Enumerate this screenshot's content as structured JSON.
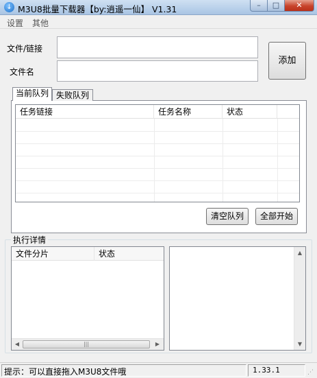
{
  "window": {
    "title": "M3U8批量下载器【by:逍遥一仙】 V1.31",
    "icon": "download-arrow-icon"
  },
  "menu": [
    "设置",
    "其他"
  ],
  "form": {
    "file_link_label": "文件/链接",
    "file_link_value": "",
    "file_name_label": "文件名",
    "file_name_value": "",
    "add_label": "添加"
  },
  "tabs": [
    "当前队列",
    "失败队列"
  ],
  "queue_table": {
    "columns": [
      "任务链接",
      "任务名称",
      "状态"
    ],
    "rows": []
  },
  "queue_buttons": {
    "clear": "清空队列",
    "start_all": "全部开始"
  },
  "details": {
    "group_title": "执行详情",
    "columns": [
      "文件分片",
      "状态"
    ],
    "rows": []
  },
  "status": {
    "hint": "提示：可以直接拖入M3U8文件哦",
    "version": "1.33.1"
  }
}
